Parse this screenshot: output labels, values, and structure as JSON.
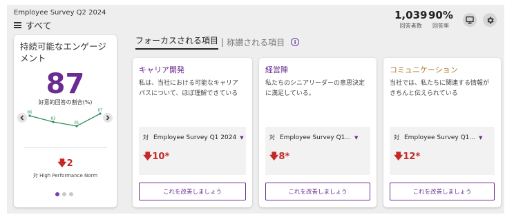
{
  "header": {
    "survey_name": "Employee Survey Q2 2024",
    "scope_label": "すべて",
    "respondents_value": "1,039",
    "respondents_label": "回答者数",
    "response_rate_value": "90%",
    "response_rate_label": "回答率"
  },
  "tabs": {
    "focus_label": "フォーカスされる項目",
    "separator": "|",
    "praise_label": "称讃される項目",
    "info_icon": "i"
  },
  "engagement_card": {
    "title": "持続可能なエンゲージメント",
    "score": "87",
    "score_label": "好意的回答の割合(%)",
    "trend_values": [
      86,
      83,
      81,
      87
    ],
    "trend_labels": [
      "86",
      "83",
      "81",
      "87"
    ],
    "delta": "🡇2",
    "norm_label": "対 High Performance Norm",
    "page_count": 3,
    "active_page": 0,
    "accent_color": "#6a2c91",
    "negative_color": "#c62828"
  },
  "focus_cards": [
    {
      "title": "キャリア開発",
      "title_color": "#6a2c91",
      "description_lines": [
        "私は、当社における可能なキャリア",
        "パスについて、ほぼ理解できている"
      ],
      "compare_prefix": "対",
      "compare_label": "Employee Survey Q1 2024",
      "delta": "🡇10*",
      "button_label": "これを改善しましょう"
    },
    {
      "title": "経営陣",
      "title_color": "#6a2c91",
      "description_lines": [
        "私たちのシニアリーダーの意思決定",
        "に満足している。"
      ],
      "compare_prefix": "対",
      "compare_label": "Employee Survey Q1...",
      "delta": "🡇8*",
      "button_label": "これを改善しましょう"
    },
    {
      "title": "コミュニケーション",
      "title_color": "#b07a2a",
      "description_lines": [
        "当社では、私たちに関連する情報が",
        "きちんと伝えられている"
      ],
      "compare_prefix": "対",
      "compare_label": "Employee Survey Q1...",
      "delta": "🡇12*",
      "button_label": "これを改善しましょう"
    }
  ]
}
